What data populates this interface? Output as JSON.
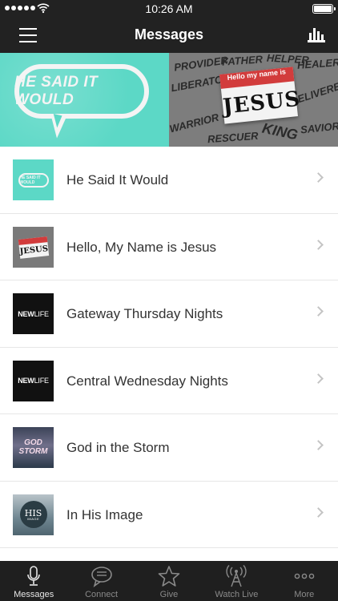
{
  "status_bar": {
    "time": "10:26 AM"
  },
  "nav": {
    "title": "Messages"
  },
  "hero": {
    "left_text": "HE SAID IT WOULD",
    "right_name": "JESUS",
    "right_hello": "Hello my name is",
    "right_words": [
      "PROVIDER",
      "FATHER",
      "HELPER",
      "HEALER",
      "LIBERATOR",
      "DELIVERER",
      "WARRIOR",
      "RESCUER",
      "KING",
      "SAVIOR"
    ]
  },
  "list": {
    "items": [
      {
        "label": "He Said It Would",
        "thumb_text": "HE SAID IT WOULD"
      },
      {
        "label": "Hello, My Name is Jesus",
        "thumb_text": "JESUS"
      },
      {
        "label": "Gateway Thursday Nights",
        "thumb_text_a": "NEW",
        "thumb_text_b": "LIFE"
      },
      {
        "label": "Central Wednesday Nights",
        "thumb_text_a": "NEW",
        "thumb_text_b": "LIFE"
      },
      {
        "label": "God in the Storm",
        "thumb_text_a": "GOD",
        "thumb_text_b": "STORM"
      },
      {
        "label": "In His Image",
        "thumb_text_a": "HIS",
        "thumb_text_b": "IMAGE"
      }
    ]
  },
  "tabs": [
    {
      "label": "Messages",
      "icon": "microphone-icon",
      "active": true
    },
    {
      "label": "Connect",
      "icon": "chat-bubble-icon",
      "active": false
    },
    {
      "label": "Give",
      "icon": "star-icon",
      "active": false
    },
    {
      "label": "Watch Live",
      "icon": "broadcast-tower-icon",
      "active": false
    },
    {
      "label": "More",
      "icon": "more-dots-icon",
      "active": false
    }
  ],
  "colors": {
    "bar": "#222222",
    "teal": "#5cd8c6",
    "accent_red": "#d23c3c",
    "tab_bar": "#1f1f1f"
  }
}
